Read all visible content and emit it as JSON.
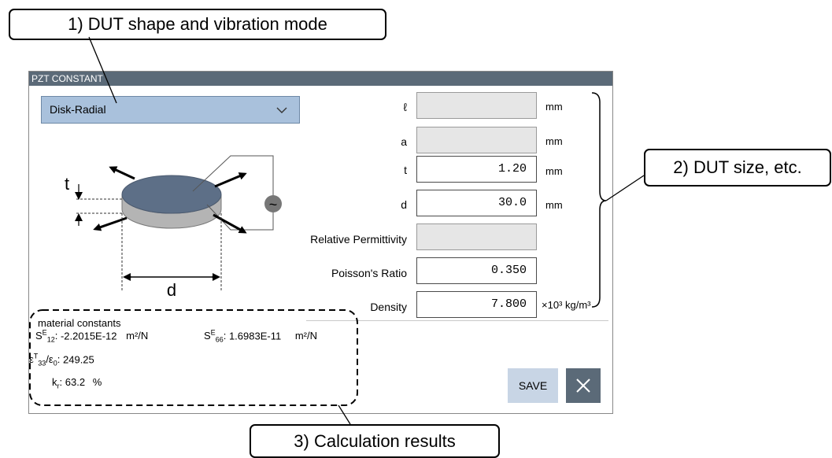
{
  "callouts": {
    "c1": "1) DUT shape and vibration mode",
    "c2": "2) DUT size, etc.",
    "c3": "3) Calculation results"
  },
  "dialog": {
    "title": "PZT CONSTANT",
    "mode_select": "Disk-Radial",
    "diagram": {
      "t_label": "t",
      "d_label": "d",
      "source_symbol": "~"
    },
    "fields": [
      {
        "label": "ℓ",
        "value": "",
        "unit": "mm",
        "enabled": false
      },
      {
        "label": "a",
        "value": "",
        "unit": "mm",
        "enabled": false
      },
      {
        "label": "t",
        "value": "1.20",
        "unit": "mm",
        "enabled": true
      },
      {
        "label": "d",
        "value": "30.0",
        "unit": "mm",
        "enabled": true
      },
      {
        "label": "Relative Permittivity",
        "value": "",
        "unit": "",
        "enabled": false
      },
      {
        "label": "Poisson's Ratio",
        "value": "0.350",
        "unit": "",
        "enabled": true
      },
      {
        "label": "Density",
        "value": "7.800",
        "unit": "×10³ kg/m³",
        "enabled": true
      }
    ],
    "material": {
      "title": "material constants",
      "s12_value": "-2.2015E-12",
      "s12_unit": "m²/N",
      "s66_value": "1.6983E-11",
      "s66_unit": "m²/N",
      "eps_value": "249.25",
      "kr_value": "63.2",
      "kr_unit": "%"
    },
    "save_label": "SAVE"
  }
}
